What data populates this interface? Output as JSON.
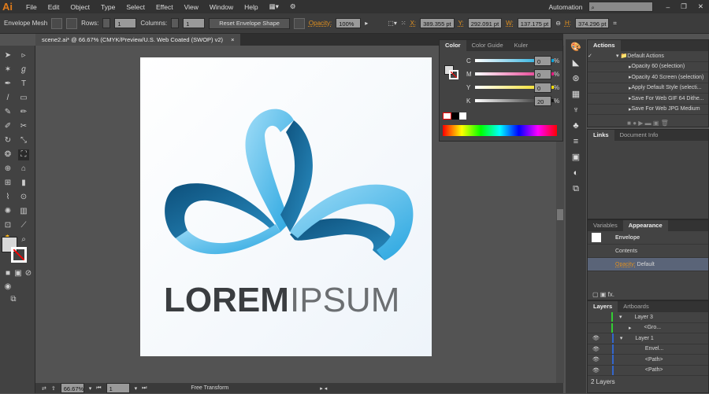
{
  "app": {
    "logo": "Ai",
    "menus": [
      "File",
      "Edit",
      "Object",
      "Type",
      "Select",
      "Effect",
      "View",
      "Window",
      "Help"
    ],
    "workspace": "Automation"
  },
  "control": {
    "mode": "Envelope Mesh",
    "rows_label": "Rows:",
    "rows": "1",
    "cols_label": "Columns:",
    "cols": "1",
    "reset": "Reset Envelope Shape",
    "opacity_label": "Opacity:",
    "opacity": "100%",
    "x_label": "X:",
    "x": "389.355 pt",
    "y_label": "Y:",
    "y": "292.091 pt",
    "w_label": "W:",
    "w": "137.175 pt",
    "h_label": "H:",
    "h": "374.296 pt"
  },
  "document": {
    "tab": "scene2.ai* @ 66.67% (CMYK/Preview/U.S. Web Coated (SWOP) v2)",
    "close": "×",
    "logo_word1": "LOREM",
    "logo_word2": "IPSUM"
  },
  "status": {
    "zoom": "66.67%",
    "page": "1",
    "tool": "Free Transform"
  },
  "color_panel": {
    "tabs": [
      "Color",
      "Color Guide",
      "Kuler"
    ],
    "channels": [
      {
        "label": "C",
        "value": "0"
      },
      {
        "label": "M",
        "value": "0"
      },
      {
        "label": "Y",
        "value": "0"
      },
      {
        "label": "K",
        "value": "20"
      }
    ],
    "pct": "%"
  },
  "actions": {
    "title": "Actions",
    "items": [
      "Default Actions",
      "Opacity 60 (selection)",
      "Opacity 40 Screen (selection)",
      "Apply Default Style (selecti...",
      "Save For Web GIF 64 Dithe...",
      "Save For Web JPG Medium"
    ]
  },
  "links": {
    "tabs": [
      "Links",
      "Document Info"
    ]
  },
  "appearance": {
    "tabs": [
      "Variables",
      "Appearance"
    ],
    "object": "Envelope",
    "contents": "Contents",
    "opacity_label": "Opacity:",
    "opacity": "Default",
    "fx": "fx."
  },
  "layers": {
    "tabs": [
      "Layers",
      "Artboards"
    ],
    "rows": [
      "Layer 3",
      "<Gro...",
      "Layer 1",
      "Envel...",
      "<Path>",
      "<Path>"
    ],
    "count": "2 Layers"
  }
}
